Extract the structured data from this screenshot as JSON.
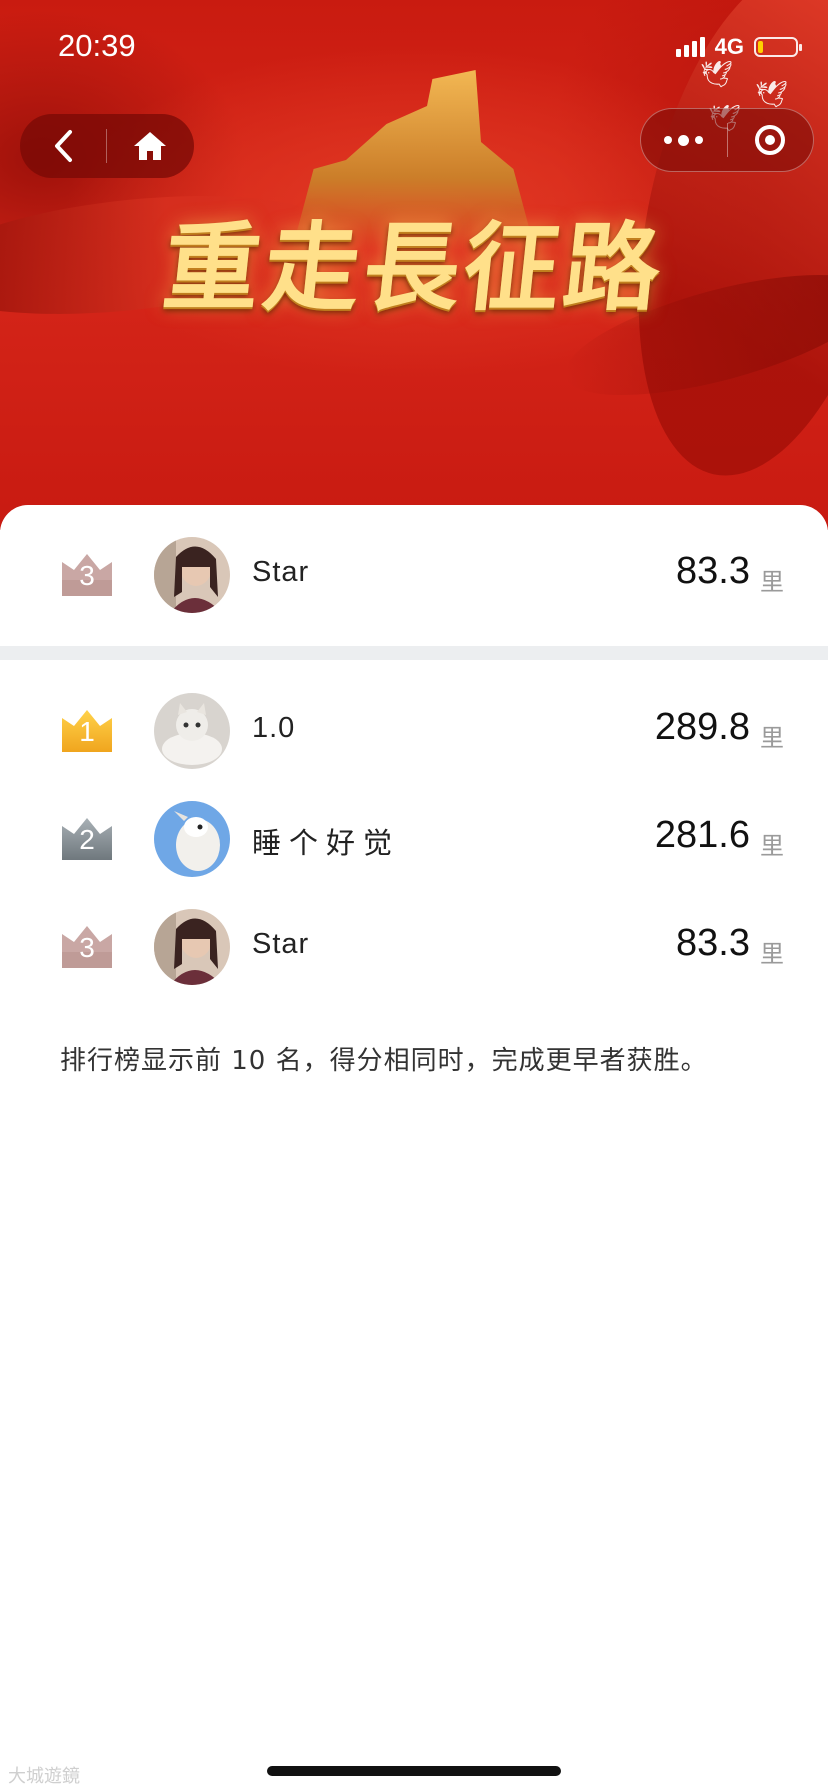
{
  "status_bar": {
    "time": "20:39",
    "network": "4G",
    "battery_level": 0.15
  },
  "banner": {
    "title": "重走長征路"
  },
  "capsule": {
    "back_icon": "chevron-left-icon",
    "home_icon": "home-icon",
    "more_icon": "more-dots-icon",
    "close_icon": "target-icon"
  },
  "my_rank": {
    "rank": "3",
    "name": "Star",
    "score": "83.3",
    "unit": "里"
  },
  "leaderboard": [
    {
      "rank": "1",
      "name": "1.0",
      "score": "289.8",
      "unit": "里"
    },
    {
      "rank": "2",
      "name": "睡个好觉",
      "score": "281.6",
      "unit": "里"
    },
    {
      "rank": "3",
      "name": "Star",
      "score": "83.3",
      "unit": "里"
    }
  ],
  "footer_note": "排行榜显示前 10 名，得分相同时，完成更早者获胜。",
  "watermark": "大城遊鏡",
  "colors": {
    "gold": "#f5c23a",
    "silver": "#8e979c",
    "bronze": "#c9a7a4",
    "banner_red": "#d0231a"
  }
}
